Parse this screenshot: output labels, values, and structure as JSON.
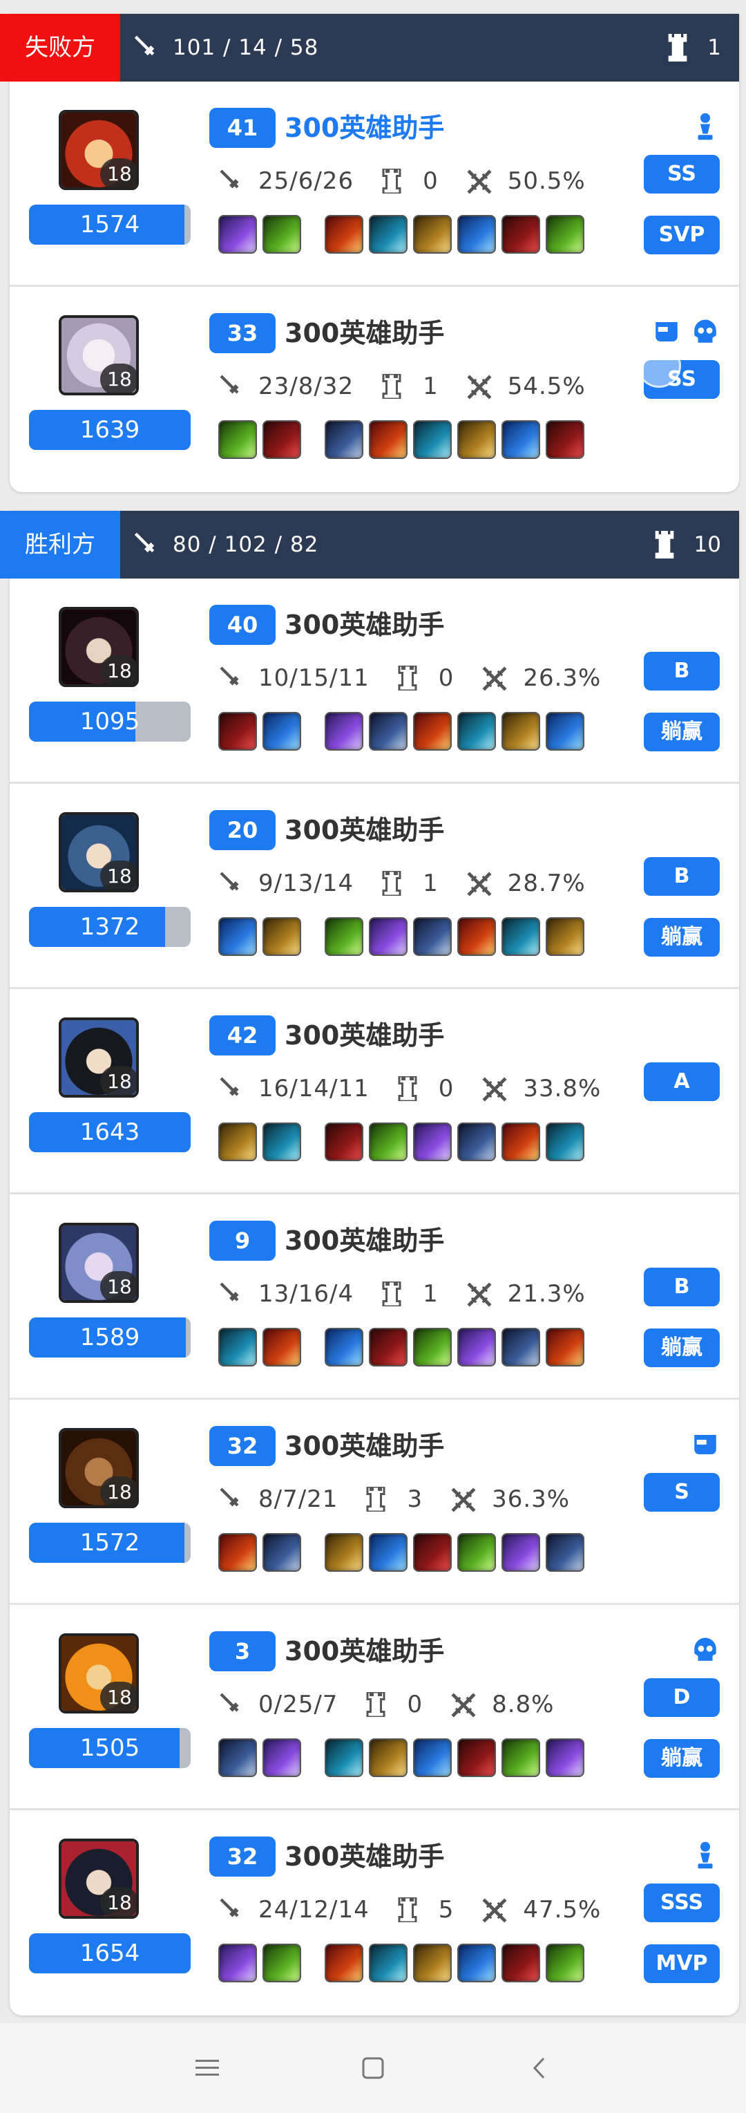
{
  "colors": {
    "accent": "#1d7af0",
    "lose": "#f01010",
    "header": "#2b3a52"
  },
  "teams": [
    {
      "result_label": "失败方",
      "kda": "101 / 14 / 58",
      "towers": "1",
      "players": [
        {
          "level": "41",
          "name": "300英雄助手",
          "name_highlight": true,
          "hero_level": "18",
          "rating": "1574",
          "rating_fill": 0.96,
          "kda": "25/6/26",
          "towers": "0",
          "damage": "50.5%",
          "grade": "SS",
          "award": "SVP",
          "badges": [
            "mvp-statue-icon"
          ]
        },
        {
          "level": "33",
          "name": "300英雄助手",
          "name_highlight": false,
          "hero_level": "18",
          "rating": "1639",
          "rating_fill": 1.0,
          "kda": "23/8/32",
          "towers": "1",
          "damage": "54.5%",
          "grade": "SS",
          "award": "",
          "badges": [
            "tank-icon",
            "skull-icon"
          ]
        }
      ]
    },
    {
      "result_label": "胜利方",
      "kda": "80 / 102 / 82",
      "towers": "10",
      "players": [
        {
          "level": "40",
          "name": "300英雄助手",
          "name_highlight": false,
          "hero_level": "18",
          "rating": "1095",
          "rating_fill": 0.66,
          "kda": "10/15/11",
          "towers": "0",
          "damage": "26.3%",
          "grade": "B",
          "award": "躺赢",
          "badges": []
        },
        {
          "level": "20",
          "name": "300英雄助手",
          "name_highlight": false,
          "hero_level": "18",
          "rating": "1372",
          "rating_fill": 0.84,
          "kda": "9/13/14",
          "towers": "1",
          "damage": "28.7%",
          "grade": "B",
          "award": "躺赢",
          "badges": []
        },
        {
          "level": "42",
          "name": "300英雄助手",
          "name_highlight": false,
          "hero_level": "18",
          "rating": "1643",
          "rating_fill": 1.0,
          "kda": "16/14/11",
          "towers": "0",
          "damage": "33.8%",
          "grade": "A",
          "award": "",
          "badges": []
        },
        {
          "level": "9",
          "name": "300英雄助手",
          "name_highlight": false,
          "hero_level": "18",
          "rating": "1589",
          "rating_fill": 0.97,
          "kda": "13/16/4",
          "towers": "1",
          "damage": "21.3%",
          "grade": "B",
          "award": "躺赢",
          "badges": []
        },
        {
          "level": "32",
          "name": "300英雄助手",
          "name_highlight": false,
          "hero_level": "18",
          "rating": "1572",
          "rating_fill": 0.96,
          "kda": "8/7/21",
          "towers": "3",
          "damage": "36.3%",
          "grade": "S",
          "award": "",
          "badges": [
            "tank-icon"
          ]
        },
        {
          "level": "3",
          "name": "300英雄助手",
          "name_highlight": false,
          "hero_level": "18",
          "rating": "1505",
          "rating_fill": 0.93,
          "kda": "0/25/7",
          "towers": "0",
          "damage": "8.8%",
          "grade": "D",
          "award": "躺赢",
          "badges": [
            "skull-icon"
          ]
        },
        {
          "level": "32",
          "name": "300英雄助手",
          "name_highlight": false,
          "hero_level": "18",
          "rating": "1654",
          "rating_fill": 1.0,
          "kda": "24/12/14",
          "towers": "5",
          "damage": "47.5%",
          "grade": "SSS",
          "award": "MVP",
          "badges": [
            "mvp-statue-icon"
          ]
        }
      ]
    }
  ],
  "navbar": {
    "items": [
      "menu-icon",
      "home-icon",
      "back-icon"
    ]
  }
}
